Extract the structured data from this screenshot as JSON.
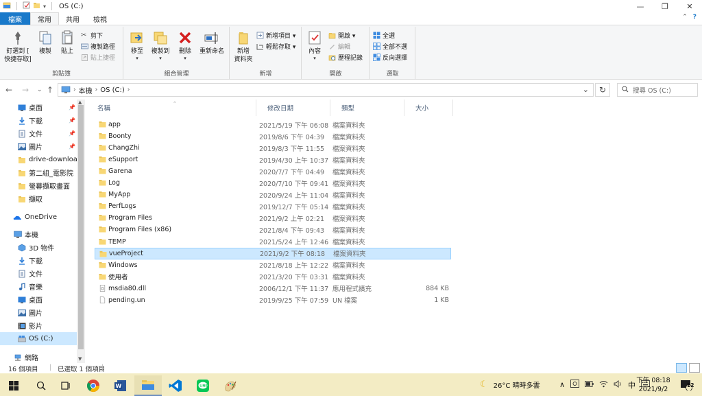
{
  "window": {
    "title": "OS (C:)",
    "controls": {
      "minimize": "—",
      "maximize": "❐",
      "close": "✕"
    }
  },
  "ribbon_tabs": [
    "檔案",
    "常用",
    "共用",
    "檢視"
  ],
  "ribbon": {
    "clipboard": {
      "label": "剪貼簿",
      "pin": "釘選到 [\n快捷存取]",
      "copy": "複製",
      "paste": "貼上",
      "cut": "剪下",
      "copy_path": "複製路徑",
      "paste_shortcut": "貼上捷徑"
    },
    "organize": {
      "label": "組合管理",
      "move_to": "移至",
      "copy_to": "複製到",
      "delete": "刪除",
      "rename": "重新命名"
    },
    "new": {
      "label": "新增",
      "new_folder": "新增\n資料夾",
      "new_item": "新增項目 ▾",
      "easy_access": "輕鬆存取 ▾"
    },
    "open": {
      "label": "開啟",
      "properties": "內容",
      "open": "開啟 ▾",
      "edit": "編輯",
      "history": "歷程記錄"
    },
    "select": {
      "label": "選取",
      "select_all": "全選",
      "select_none": "全部不選",
      "invert": "反向選擇"
    }
  },
  "address": {
    "back": "←",
    "forward": "→",
    "up": "↑",
    "crumbs": [
      "本機",
      "OS (C:)"
    ],
    "dropdown": "⌄",
    "refresh": "↻",
    "search_placeholder": "搜尋 OS (C:)"
  },
  "nav": {
    "quick_access": [
      {
        "label": "桌面",
        "icon": "desktop-icon",
        "pinned": true
      },
      {
        "label": "下載",
        "icon": "download-icon",
        "pinned": true
      },
      {
        "label": "文件",
        "icon": "documents-icon",
        "pinned": true
      },
      {
        "label": "圖片",
        "icon": "pictures-icon",
        "pinned": true
      },
      {
        "label": "drive-download",
        "icon": "folder-icon",
        "pinned": false
      },
      {
        "label": "第二組_電影院",
        "icon": "folder-icon",
        "pinned": false
      },
      {
        "label": "螢幕擷取畫面",
        "icon": "folder-icon",
        "pinned": false
      },
      {
        "label": "擷取",
        "icon": "folder-icon",
        "pinned": false
      }
    ],
    "onedrive": "OneDrive",
    "this_pc": "本機",
    "this_pc_items": [
      {
        "label": "3D 物件",
        "icon": "3d-objects-icon"
      },
      {
        "label": "下載",
        "icon": "download-icon"
      },
      {
        "label": "文件",
        "icon": "documents-icon"
      },
      {
        "label": "音樂",
        "icon": "music-icon"
      },
      {
        "label": "桌面",
        "icon": "desktop-icon"
      },
      {
        "label": "圖片",
        "icon": "pictures-icon"
      },
      {
        "label": "影片",
        "icon": "videos-icon"
      },
      {
        "label": "OS (C:)",
        "icon": "drive-icon",
        "selected": true
      }
    ],
    "network": "網路",
    "pin_glyph": "📌"
  },
  "columns": {
    "name": "名稱",
    "modified": "修改日期",
    "type": "類型",
    "size": "大小"
  },
  "files": [
    {
      "name": "app",
      "modified": "2021/5/19 下午 06:08",
      "type": "檔案資料夾",
      "size": "",
      "kind": "folder"
    },
    {
      "name": "Boonty",
      "modified": "2019/8/6 下午 04:39",
      "type": "檔案資料夾",
      "size": "",
      "kind": "folder"
    },
    {
      "name": "ChangZhi",
      "modified": "2019/8/3 下午 11:55",
      "type": "檔案資料夾",
      "size": "",
      "kind": "folder"
    },
    {
      "name": "eSupport",
      "modified": "2019/4/30 上午 10:37",
      "type": "檔案資料夾",
      "size": "",
      "kind": "folder"
    },
    {
      "name": "Garena",
      "modified": "2020/7/7 下午 04:49",
      "type": "檔案資料夾",
      "size": "",
      "kind": "folder"
    },
    {
      "name": "Log",
      "modified": "2020/7/10 下午 09:41",
      "type": "檔案資料夾",
      "size": "",
      "kind": "folder"
    },
    {
      "name": "MyApp",
      "modified": "2020/9/24 上午 11:04",
      "type": "檔案資料夾",
      "size": "",
      "kind": "folder"
    },
    {
      "name": "PerfLogs",
      "modified": "2019/12/7 下午 05:14",
      "type": "檔案資料夾",
      "size": "",
      "kind": "folder"
    },
    {
      "name": "Program Files",
      "modified": "2021/9/2 上午 02:21",
      "type": "檔案資料夾",
      "size": "",
      "kind": "folder"
    },
    {
      "name": "Program Files (x86)",
      "modified": "2021/8/4 下午 09:43",
      "type": "檔案資料夾",
      "size": "",
      "kind": "folder"
    },
    {
      "name": "TEMP",
      "modified": "2021/5/24 上午 12:46",
      "type": "檔案資料夾",
      "size": "",
      "kind": "folder"
    },
    {
      "name": "vueProject",
      "modified": "2021/9/2 下午 08:18",
      "type": "檔案資料夾",
      "size": "",
      "kind": "folder",
      "selected": true
    },
    {
      "name": "Windows",
      "modified": "2021/8/18 上午 12:22",
      "type": "檔案資料夾",
      "size": "",
      "kind": "folder"
    },
    {
      "name": "使用者",
      "modified": "2021/3/20 下午 03:31",
      "type": "檔案資料夾",
      "size": "",
      "kind": "folder"
    },
    {
      "name": "msdia80.dll",
      "modified": "2006/12/1 下午 11:37",
      "type": "應用程式擴充",
      "size": "884 KB",
      "kind": "dll"
    },
    {
      "name": "pending.un",
      "modified": "2019/9/25 下午 07:59",
      "type": "UN 檔案",
      "size": "1 KB",
      "kind": "file"
    }
  ],
  "status": {
    "count": "16 個項目",
    "selected": "已選取 1 個項目"
  },
  "taskbar": {
    "apps": [
      "start-icon",
      "search-icon",
      "task-view-icon",
      "chrome-icon",
      "word-icon",
      "file-explorer-icon",
      "vscode-icon",
      "line-icon",
      "paint-icon"
    ],
    "weather": "26°C  晴時多雲",
    "ime": "中",
    "time": "下午 08:18",
    "date": "2021/9/2",
    "notifications": "12"
  },
  "colors": {
    "file_tab": "#1979ca",
    "selection": "#cce8ff",
    "selection_border": "#99d1ff",
    "folder": "#f8d775",
    "taskbar": "#f3ecc4"
  }
}
